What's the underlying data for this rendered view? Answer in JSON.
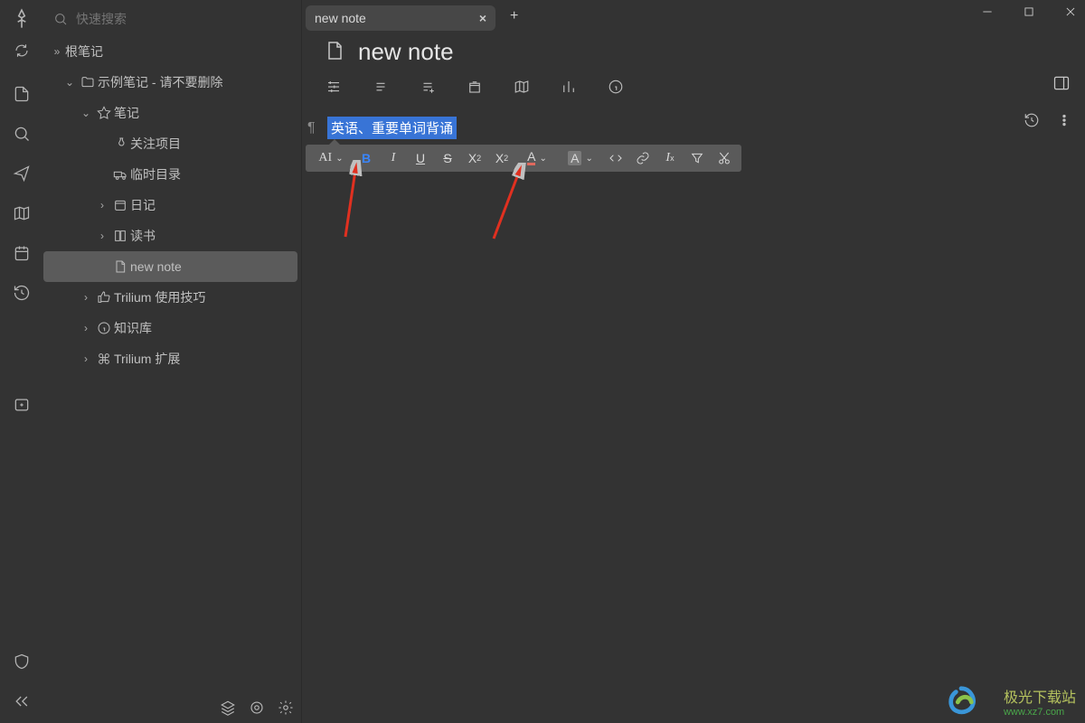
{
  "search": {
    "placeholder": "快速搜索"
  },
  "tree": {
    "root_label": "根笔记",
    "n0_label": "示例笔记 - 请不要删除",
    "n1_label": "笔记",
    "n1a_label": "关注项目",
    "n1b_label": "临时目录",
    "n1c_label": "日记",
    "n1d_label": "读书",
    "n1e_label": "new note",
    "n2_label": "Trilium 使用技巧",
    "n3_label": "知识库",
    "n4_label": "Trilium 扩展"
  },
  "tab": {
    "title": "new note"
  },
  "note": {
    "title": "new note"
  },
  "editor": {
    "selected_text": "英语、重要单词背诵"
  },
  "watermark": {
    "line1": "极光下载站",
    "line2": "www.xz7.com"
  }
}
